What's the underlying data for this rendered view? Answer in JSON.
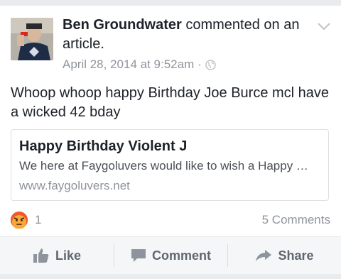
{
  "post": {
    "author": "Ben Groundwater",
    "action_text": " commented on an article.",
    "timestamp": "April 28, 2014 at 9:52am",
    "separator": "·",
    "privacy_icon": "globe-icon",
    "menu_icon": "chevron-down-icon",
    "body": "Whoop whoop happy Birthday Joe Burce mcl have a wicked 42 bday"
  },
  "link": {
    "title": "Happy Birthday Violent J",
    "description": "We here at Faygoluvers would like to wish a Happy …",
    "domain": "www.faygoluvers.net"
  },
  "stats": {
    "reaction_icon": "angry-reaction-icon",
    "reaction_count": "1",
    "comments": "5 Comments"
  },
  "actions": {
    "like": "Like",
    "comment": "Comment",
    "share": "Share"
  },
  "colors": {
    "reaction_angry": "#f05a28",
    "text_primary": "#1d2129",
    "text_secondary": "#90949c",
    "action_text": "#606770"
  }
}
